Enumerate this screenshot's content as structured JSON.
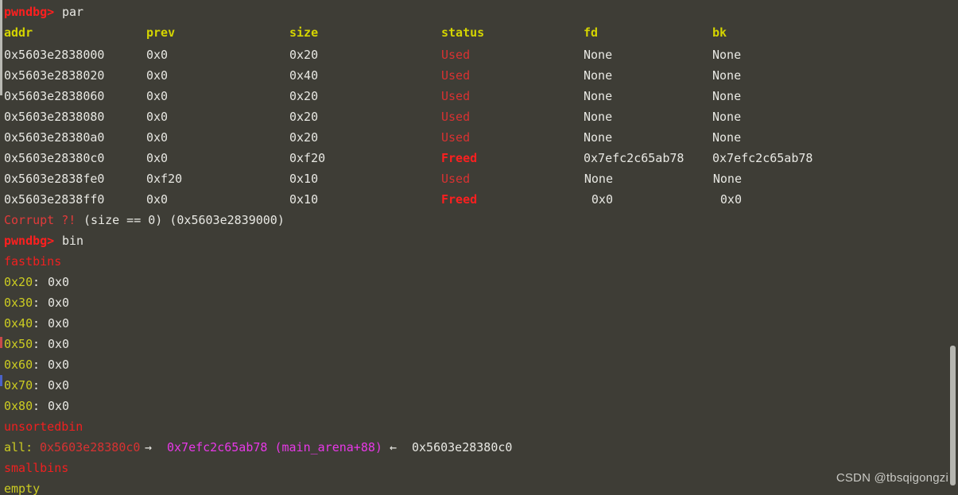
{
  "terminal": {
    "background": "#3e3d36",
    "foreground": "#e8e8e3",
    "watermark": "CSDN @tbsqigongzi"
  },
  "colors": {
    "prompt": "#ff1f1f",
    "header": "#d4d400",
    "used": "#d83232",
    "freed": "#ff1f1f",
    "olive": "#cccc22",
    "magenta": "#e838e8",
    "white": "#e8e8e3"
  },
  "prompts": {
    "symbol": "pwndbg>",
    "command_1": "par",
    "command_2": "bin"
  },
  "heap_table": {
    "headers": {
      "addr": "addr",
      "prev": "prev",
      "size": "size",
      "status": "status",
      "fd": "fd",
      "bk": "bk"
    },
    "rows": [
      {
        "addr": "0x5603e2838000",
        "prev": "0x0",
        "size": "0x20",
        "status": "Used",
        "fd": "None",
        "bk": "None",
        "align": "left"
      },
      {
        "addr": "0x5603e2838020",
        "prev": "0x0",
        "size": "0x40",
        "status": "Used",
        "fd": "None",
        "bk": "None",
        "align": "left"
      },
      {
        "addr": "0x5603e2838060",
        "prev": "0x0",
        "size": "0x20",
        "status": "Used",
        "fd": "None",
        "bk": "None",
        "align": "left"
      },
      {
        "addr": "0x5603e2838080",
        "prev": "0x0",
        "size": "0x20",
        "status": "Used",
        "fd": "None",
        "bk": "None",
        "align": "left"
      },
      {
        "addr": "0x5603e28380a0",
        "prev": "0x0",
        "size": "0x20",
        "status": "Used",
        "fd": "None",
        "bk": "None",
        "align": "left"
      },
      {
        "addr": "0x5603e28380c0",
        "prev": "0x0",
        "size": "0xf20",
        "status": "Freed",
        "fd": "0x7efc2c65ab78",
        "bk": "0x7efc2c65ab78",
        "align": "left"
      },
      {
        "addr": "0x5603e2838fe0",
        "prev": "0xf20",
        "size": "0x10",
        "status": "Used",
        "fd": "None",
        "bk": "None",
        "align": "right"
      },
      {
        "addr": "0x5603e2838ff0",
        "prev": "0x0",
        "size": "0x10",
        "status": "Freed",
        "fd": "0x0",
        "bk": "0x0",
        "align": "right"
      }
    ],
    "corrupt_label": "Corrupt ?!",
    "corrupt_detail": "(size == 0) (0x5603e2839000)"
  },
  "bins": {
    "fastbins_label": "fastbins",
    "fastbins": [
      {
        "size": "0x20",
        "sep": ":",
        "value": "0x0"
      },
      {
        "size": "0x30",
        "sep": ":",
        "value": "0x0"
      },
      {
        "size": "0x40",
        "sep": ":",
        "value": "0x0"
      },
      {
        "size": "0x50",
        "sep": ":",
        "value": "0x0"
      },
      {
        "size": "0x60",
        "sep": ":",
        "value": "0x0"
      },
      {
        "size": "0x70",
        "sep": ":",
        "value": "0x0"
      },
      {
        "size": "0x80",
        "sep": ":",
        "value": "0x0"
      }
    ],
    "unsortedbin_label": "unsortedbin",
    "unsorted_entry": {
      "key": "all:",
      "chunk": "0x5603e28380c0",
      "arrow_forward": "→",
      "arena": "0x7efc2c65ab78 (main_arena+88)",
      "arrow_back": "←",
      "back_chunk": "0x5603e28380c0"
    },
    "smallbins_label": "smallbins",
    "smallbins_status": "empty"
  }
}
